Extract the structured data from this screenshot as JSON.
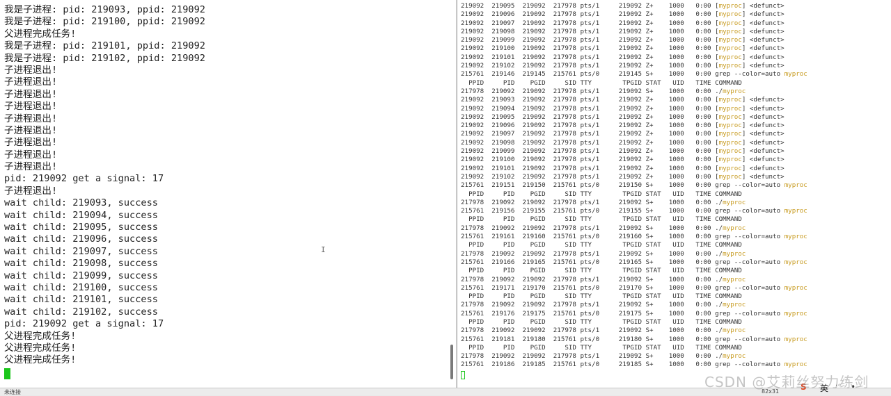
{
  "left_terminal": {
    "lines": [
      "我是子进程: pid: 219093, ppid: 219092",
      "我是子进程: pid: 219100, ppid: 219092",
      "父进程完成任务!",
      "我是子进程: pid: 219101, ppid: 219092",
      "我是子进程: pid: 219102, ppid: 219092",
      "子进程退出!",
      "子进程退出!",
      "子进程退出!",
      "子进程退出!",
      "子进程退出!",
      "子进程退出!",
      "子进程退出!",
      "子进程退出!",
      "子进程退出!",
      "pid: 219092 get a signal: 17",
      "子进程退出!",
      "wait child: 219093, success",
      "wait child: 219094, success",
      "wait child: 219095, success",
      "wait child: 219096, success",
      "wait child: 219097, success",
      "wait child: 219098, success",
      "wait child: 219099, success",
      "wait child: 219100, success",
      "wait child: 219101, success",
      "wait child: 219102, success",
      "pid: 219092 get a signal: 17",
      "父进程完成任务!",
      "父进程完成任务!",
      "父进程完成任务!"
    ]
  },
  "right_terminal": {
    "rows": [
      {
        "pre": "219092  219095  219092  217978 pts/1     219092 Z+    1000   0:00 [",
        "hl": "myproc",
        "post": "] <defunct>"
      },
      {
        "pre": "219092  219096  219092  217978 pts/1     219092 Z+    1000   0:00 [",
        "hl": "myproc",
        "post": "] <defunct>"
      },
      {
        "pre": "219092  219097  219092  217978 pts/1     219092 Z+    1000   0:00 [",
        "hl": "myproc",
        "post": "] <defunct>"
      },
      {
        "pre": "219092  219098  219092  217978 pts/1     219092 Z+    1000   0:00 [",
        "hl": "myproc",
        "post": "] <defunct>"
      },
      {
        "pre": "219092  219099  219092  217978 pts/1     219092 Z+    1000   0:00 [",
        "hl": "myproc",
        "post": "] <defunct>"
      },
      {
        "pre": "219092  219100  219092  217978 pts/1     219092 Z+    1000   0:00 [",
        "hl": "myproc",
        "post": "] <defunct>"
      },
      {
        "pre": "219092  219101  219092  217978 pts/1     219092 Z+    1000   0:00 [",
        "hl": "myproc",
        "post": "] <defunct>"
      },
      {
        "pre": "219092  219102  219092  217978 pts/1     219092 Z+    1000   0:00 [",
        "hl": "myproc",
        "post": "] <defunct>"
      },
      {
        "pre": "215761  219146  219145  215761 pts/0     219145 S+    1000   0:00 grep --color=auto ",
        "hl": "myproc",
        "post": ""
      },
      {
        "pre": "  PPID     PID    PGID     SID TTY        TPGID STAT   UID   TIME COMMAND",
        "hl": "",
        "post": ""
      },
      {
        "pre": "217978  219092  219092  217978 pts/1     219092 S+    1000   0:00 ./",
        "hl": "myproc",
        "post": ""
      },
      {
        "pre": "219092  219093  219092  217978 pts/1     219092 Z+    1000   0:00 [",
        "hl": "myproc",
        "post": "] <defunct>"
      },
      {
        "pre": "219092  219094  219092  217978 pts/1     219092 Z+    1000   0:00 [",
        "hl": "myproc",
        "post": "] <defunct>"
      },
      {
        "pre": "219092  219095  219092  217978 pts/1     219092 Z+    1000   0:00 [",
        "hl": "myproc",
        "post": "] <defunct>"
      },
      {
        "pre": "219092  219096  219092  217978 pts/1     219092 Z+    1000   0:00 [",
        "hl": "myproc",
        "post": "] <defunct>"
      },
      {
        "pre": "219092  219097  219092  217978 pts/1     219092 Z+    1000   0:00 [",
        "hl": "myproc",
        "post": "] <defunct>"
      },
      {
        "pre": "219092  219098  219092  217978 pts/1     219092 Z+    1000   0:00 [",
        "hl": "myproc",
        "post": "] <defunct>"
      },
      {
        "pre": "219092  219099  219092  217978 pts/1     219092 Z+    1000   0:00 [",
        "hl": "myproc",
        "post": "] <defunct>"
      },
      {
        "pre": "219092  219100  219092  217978 pts/1     219092 Z+    1000   0:00 [",
        "hl": "myproc",
        "post": "] <defunct>"
      },
      {
        "pre": "219092  219101  219092  217978 pts/1     219092 Z+    1000   0:00 [",
        "hl": "myproc",
        "post": "] <defunct>"
      },
      {
        "pre": "219092  219102  219092  217978 pts/1     219092 Z+    1000   0:00 [",
        "hl": "myproc",
        "post": "] <defunct>"
      },
      {
        "pre": "215761  219151  219150  215761 pts/0     219150 S+    1000   0:00 grep --color=auto ",
        "hl": "myproc",
        "post": ""
      },
      {
        "pre": "  PPID     PID    PGID     SID TTY        TPGID STAT   UID   TIME COMMAND",
        "hl": "",
        "post": ""
      },
      {
        "pre": "217978  219092  219092  217978 pts/1     219092 S+    1000   0:00 ./",
        "hl": "myproc",
        "post": ""
      },
      {
        "pre": "215761  219156  219155  215761 pts/0     219155 S+    1000   0:00 grep --color=auto ",
        "hl": "myproc",
        "post": ""
      },
      {
        "pre": "  PPID     PID    PGID     SID TTY        TPGID STAT   UID   TIME COMMAND",
        "hl": "",
        "post": ""
      },
      {
        "pre": "217978  219092  219092  217978 pts/1     219092 S+    1000   0:00 ./",
        "hl": "myproc",
        "post": ""
      },
      {
        "pre": "215761  219161  219160  215761 pts/0     219160 S+    1000   0:00 grep --color=auto ",
        "hl": "myproc",
        "post": ""
      },
      {
        "pre": "  PPID     PID    PGID     SID TTY        TPGID STAT   UID   TIME COMMAND",
        "hl": "",
        "post": ""
      },
      {
        "pre": "217978  219092  219092  217978 pts/1     219092 S+    1000   0:00 ./",
        "hl": "myproc",
        "post": ""
      },
      {
        "pre": "215761  219166  219165  215761 pts/0     219165 S+    1000   0:00 grep --color=auto ",
        "hl": "myproc",
        "post": ""
      },
      {
        "pre": "  PPID     PID    PGID     SID TTY        TPGID STAT   UID   TIME COMMAND",
        "hl": "",
        "post": ""
      },
      {
        "pre": "217978  219092  219092  217978 pts/1     219092 S+    1000   0:00 ./",
        "hl": "myproc",
        "post": ""
      },
      {
        "pre": "215761  219171  219170  215761 pts/0     219170 S+    1000   0:00 grep --color=auto ",
        "hl": "myproc",
        "post": ""
      },
      {
        "pre": "  PPID     PID    PGID     SID TTY        TPGID STAT   UID   TIME COMMAND",
        "hl": "",
        "post": ""
      },
      {
        "pre": "217978  219092  219092  217978 pts/1     219092 S+    1000   0:00 ./",
        "hl": "myproc",
        "post": ""
      },
      {
        "pre": "215761  219176  219175  215761 pts/0     219175 S+    1000   0:00 grep --color=auto ",
        "hl": "myproc",
        "post": ""
      },
      {
        "pre": "  PPID     PID    PGID     SID TTY        TPGID STAT   UID   TIME COMMAND",
        "hl": "",
        "post": ""
      },
      {
        "pre": "217978  219092  219092  217978 pts/1     219092 S+    1000   0:00 ./",
        "hl": "myproc",
        "post": ""
      },
      {
        "pre": "215761  219181  219180  215761 pts/0     219180 S+    1000   0:00 grep --color=auto ",
        "hl": "myproc",
        "post": ""
      },
      {
        "pre": "  PPID     PID    PGID     SID TTY        TPGID STAT   UID   TIME COMMAND",
        "hl": "",
        "post": ""
      },
      {
        "pre": "217978  219092  219092  217978 pts/1     219092 S+    1000   0:00 ./",
        "hl": "myproc",
        "post": ""
      },
      {
        "pre": "215761  219186  219185  215761 pts/0     219185 S+    1000   0:00 grep --color=auto ",
        "hl": "myproc",
        "post": ""
      }
    ]
  },
  "status_bar": {
    "left_text": "未连接",
    "size_text": "82x31"
  },
  "tray": {
    "app_icon": "S",
    "ime_label": "英",
    "mic_icon": "·◦",
    "pin_icon": "•"
  },
  "watermark": "CSDN @艾莉丝努力练剑",
  "colors": {
    "highlight": "#c79a1e",
    "cursor": "#1bc61b",
    "text": "#222222"
  }
}
